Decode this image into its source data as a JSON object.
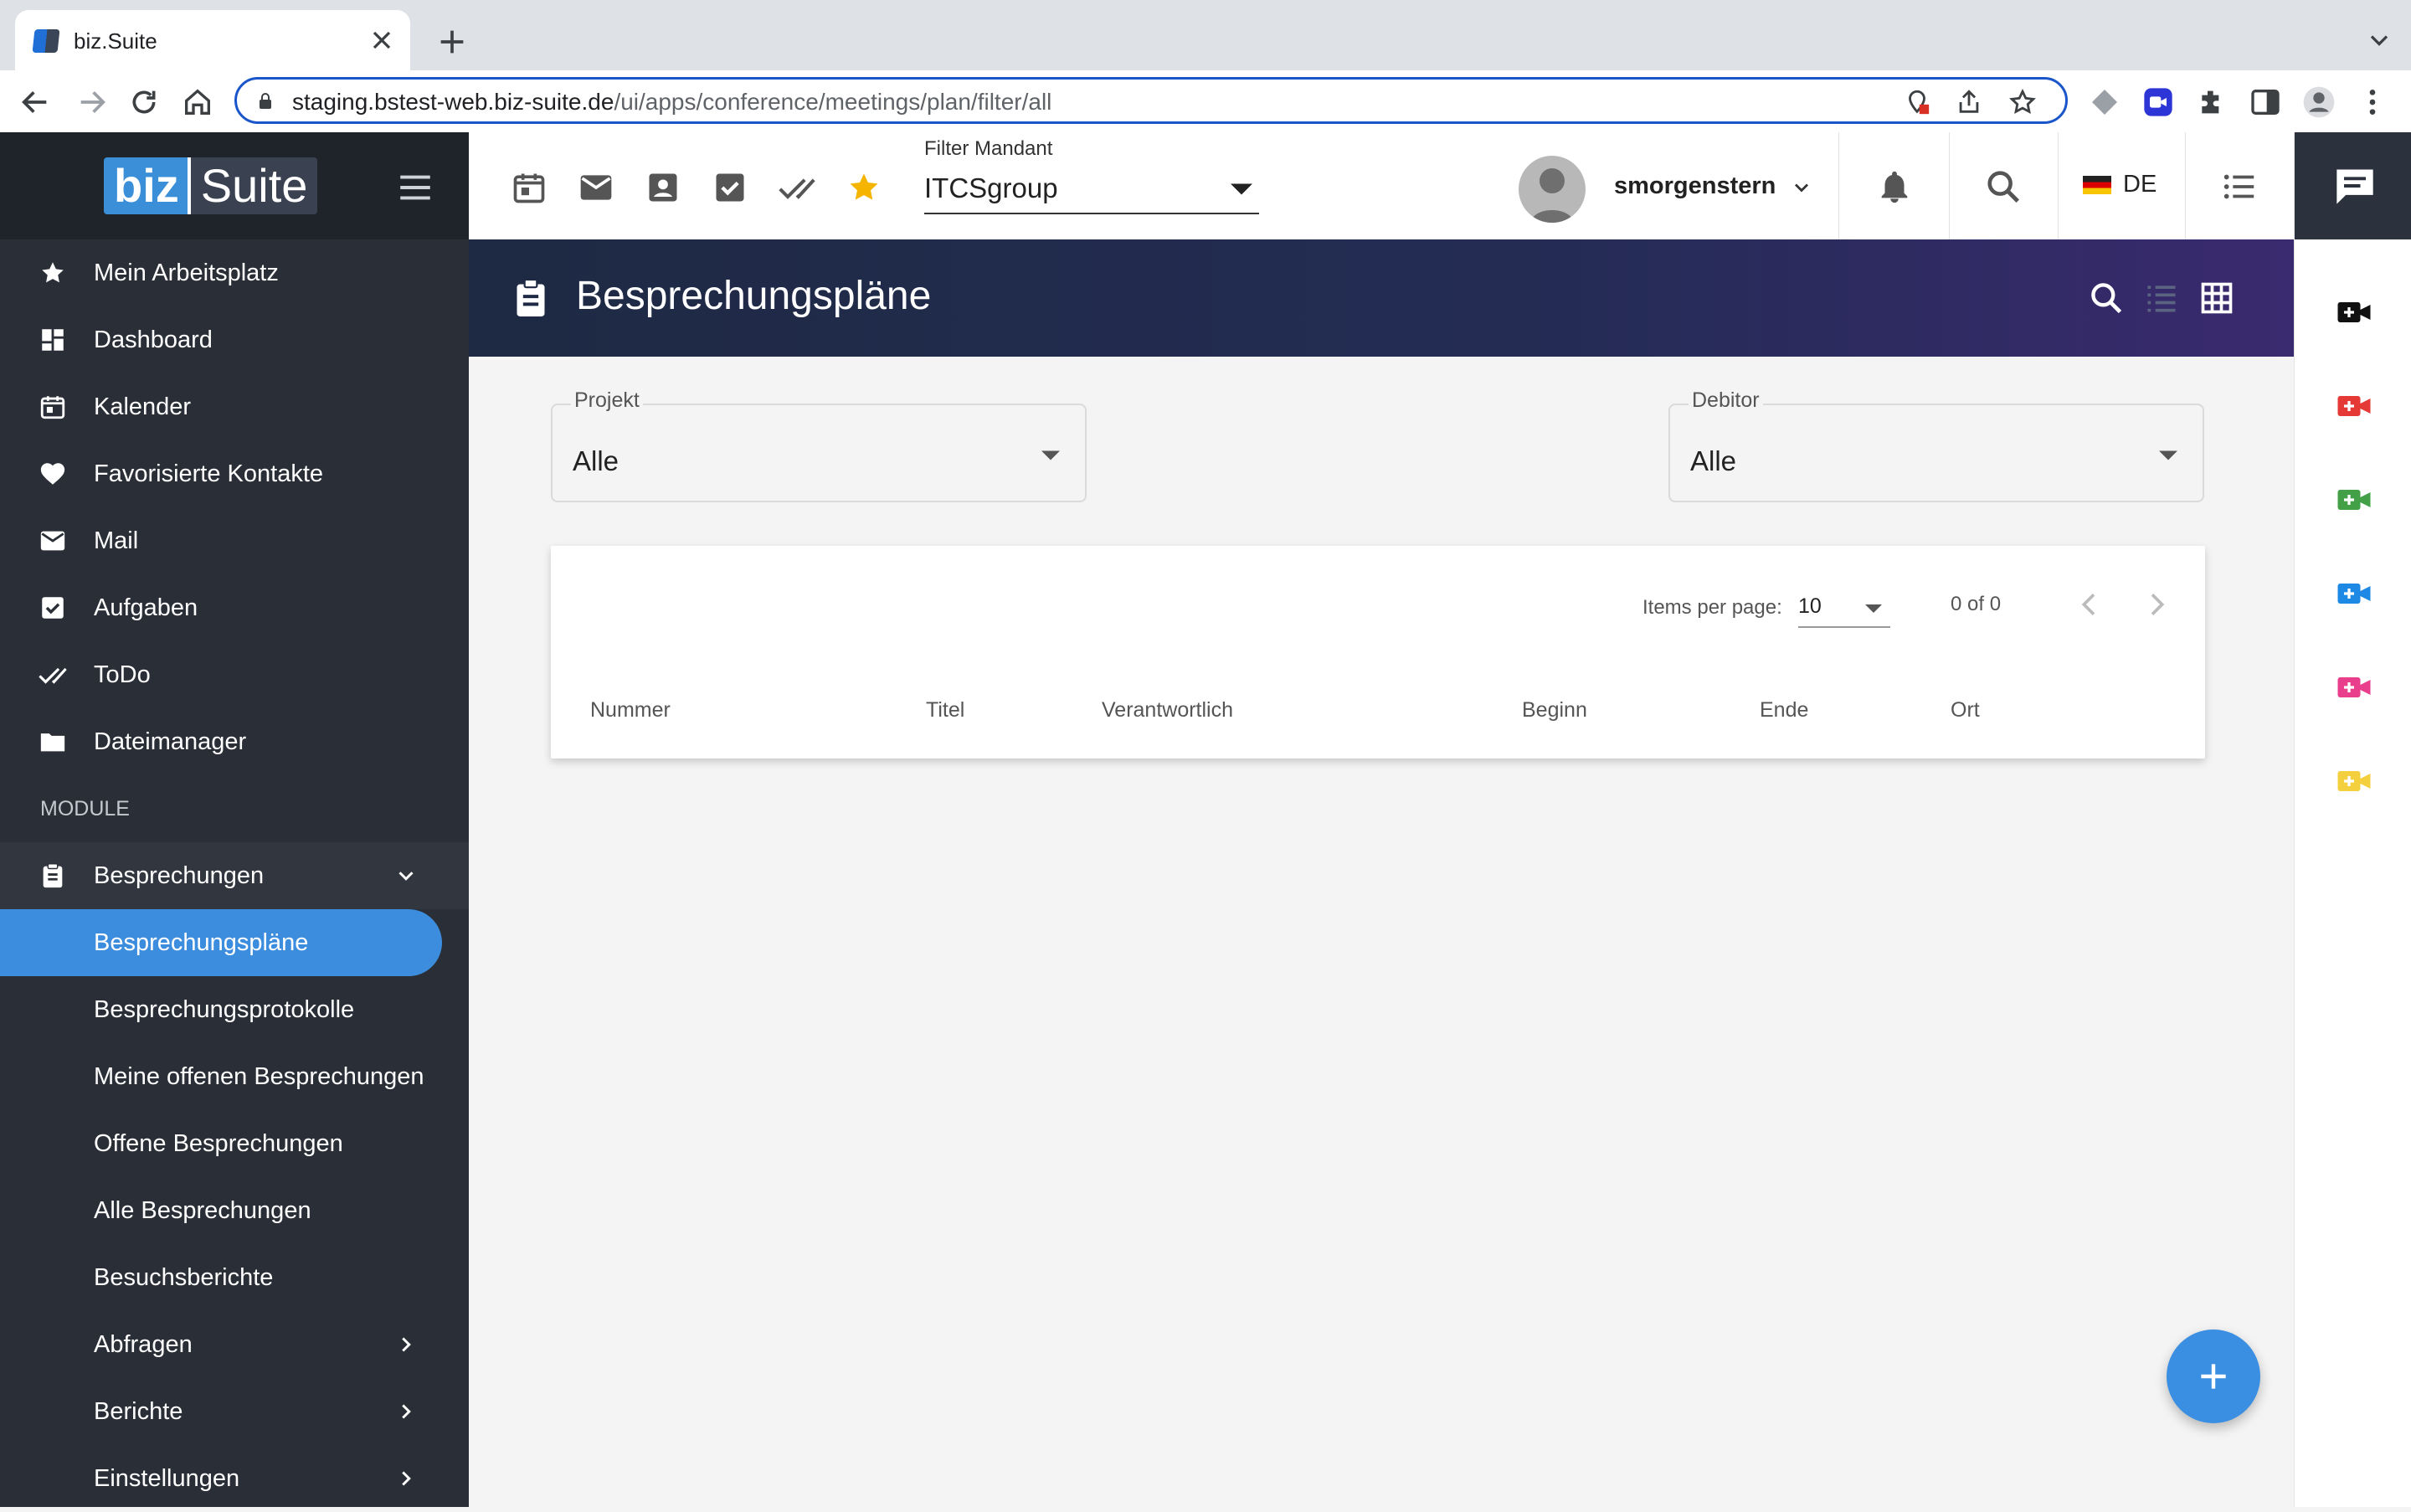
{
  "browser": {
    "tab_title": "biz.Suite",
    "url_host": "staging.bstest-web.biz-suite.de",
    "url_path": "/ui/apps/conference/meetings/plan/filter/all"
  },
  "brand": {
    "logo_part1": "biz",
    "logo_part2": "Suite"
  },
  "sidebar": {
    "items": [
      {
        "label": "Mein Arbeitsplatz",
        "icon": "star-icon"
      },
      {
        "label": "Dashboard",
        "icon": "dashboard-icon"
      },
      {
        "label": "Kalender",
        "icon": "calendar-icon"
      },
      {
        "label": "Favorisierte Kontakte",
        "icon": "heart-icon"
      },
      {
        "label": "Mail",
        "icon": "mail-icon"
      },
      {
        "label": "Aufgaben",
        "icon": "checkbox-icon"
      },
      {
        "label": "ToDo",
        "icon": "double-check-icon"
      },
      {
        "label": "Dateimanager",
        "icon": "folder-icon"
      }
    ],
    "section_label": "MODULE",
    "module_group": {
      "label": "Besprechungen",
      "icon": "clipboard-icon"
    },
    "sub_items": [
      {
        "label": "Besprechungspläne"
      },
      {
        "label": "Besprechungsprotokolle"
      },
      {
        "label": "Meine offenen Besprechungen"
      },
      {
        "label": "Offene Besprechungen"
      },
      {
        "label": "Alle Besprechungen"
      },
      {
        "label": "Besuchsberichte"
      },
      {
        "label": "Abfragen"
      },
      {
        "label": "Berichte"
      },
      {
        "label": "Einstellungen"
      }
    ]
  },
  "topbar": {
    "mandant_label": "Filter Mandant",
    "mandant_value": "ITCSgroup",
    "username": "smorgenstern",
    "language": "DE"
  },
  "page": {
    "title": "Besprechungspläne"
  },
  "filters": {
    "projekt": {
      "label": "Projekt",
      "value": "Alle"
    },
    "debitor": {
      "label": "Debitor",
      "value": "Alle"
    }
  },
  "table": {
    "items_per_page_label": "Items per page:",
    "items_per_page_value": "10",
    "range": "0 of 0",
    "columns": [
      "Nummer",
      "Titel",
      "Verantwortlich",
      "Beginn",
      "Ende",
      "Ort"
    ]
  },
  "colors": {
    "sidebar_bg": "#2a2f37",
    "accent": "#3d8ddf",
    "header_gradient_start": "#1e2a43",
    "header_gradient_end": "#3a2a6f",
    "star": "#f4b400"
  }
}
